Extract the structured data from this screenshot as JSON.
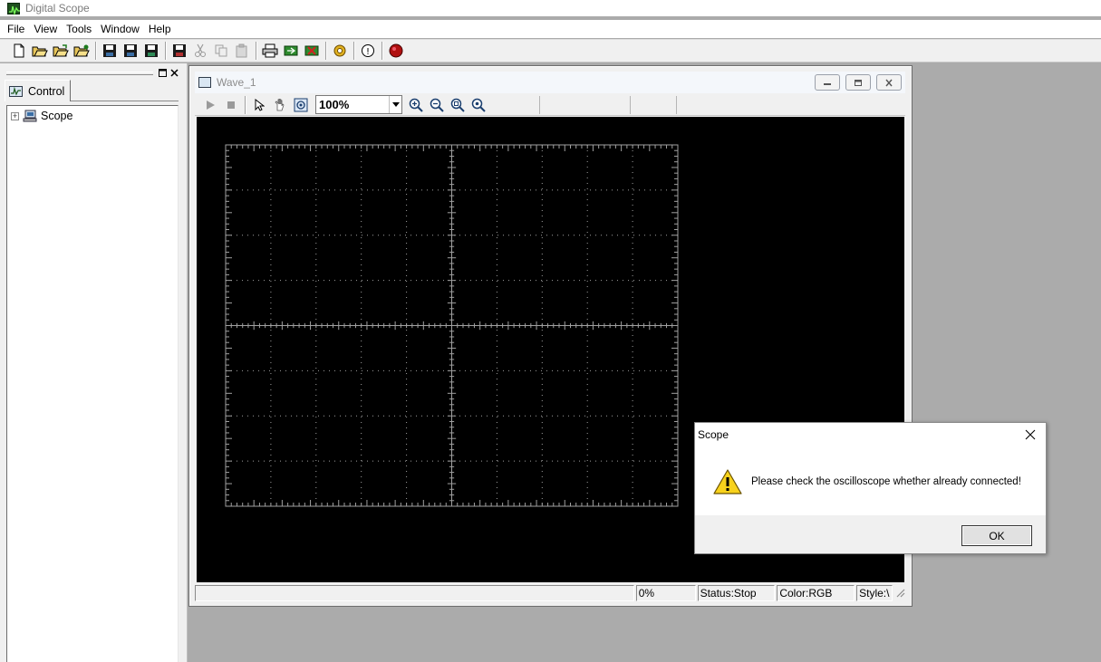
{
  "app": {
    "title": "Digital Scope",
    "icon": "scope-app-icon"
  },
  "menu": [
    "File",
    "View",
    "Tools",
    "Window",
    "Help"
  ],
  "toolbar": {
    "icons": [
      "new-file-icon",
      "open-folder-icon",
      "open-folder-2-icon",
      "open-folder-3-icon",
      "save-icon",
      "save-as-icon",
      "save-all-icon",
      "save-wave-icon",
      "cut-icon",
      "copy-icon",
      "paste-icon",
      "print-icon",
      "export-icon",
      "delete-icon",
      "settings-icon",
      "help-icon",
      "stop-record-icon"
    ]
  },
  "left_panel": {
    "tab_label": "Control",
    "tree": [
      {
        "label": "Scope",
        "expander": "+"
      }
    ]
  },
  "child_window": {
    "title": "Wave_1",
    "zoom_value": "100%",
    "status": {
      "progress": "0%",
      "state": "Status:Stop",
      "color": "Color:RGB",
      "style": "Style:\\"
    }
  },
  "dialog": {
    "title": "Scope",
    "message": "Please check the oscilloscope whether already connected!",
    "ok_label": "OK",
    "icon": "warning-icon"
  },
  "colors": {
    "screen_bg": "#000000",
    "grid": "#a0a0a0",
    "desktop": "#ababab"
  }
}
